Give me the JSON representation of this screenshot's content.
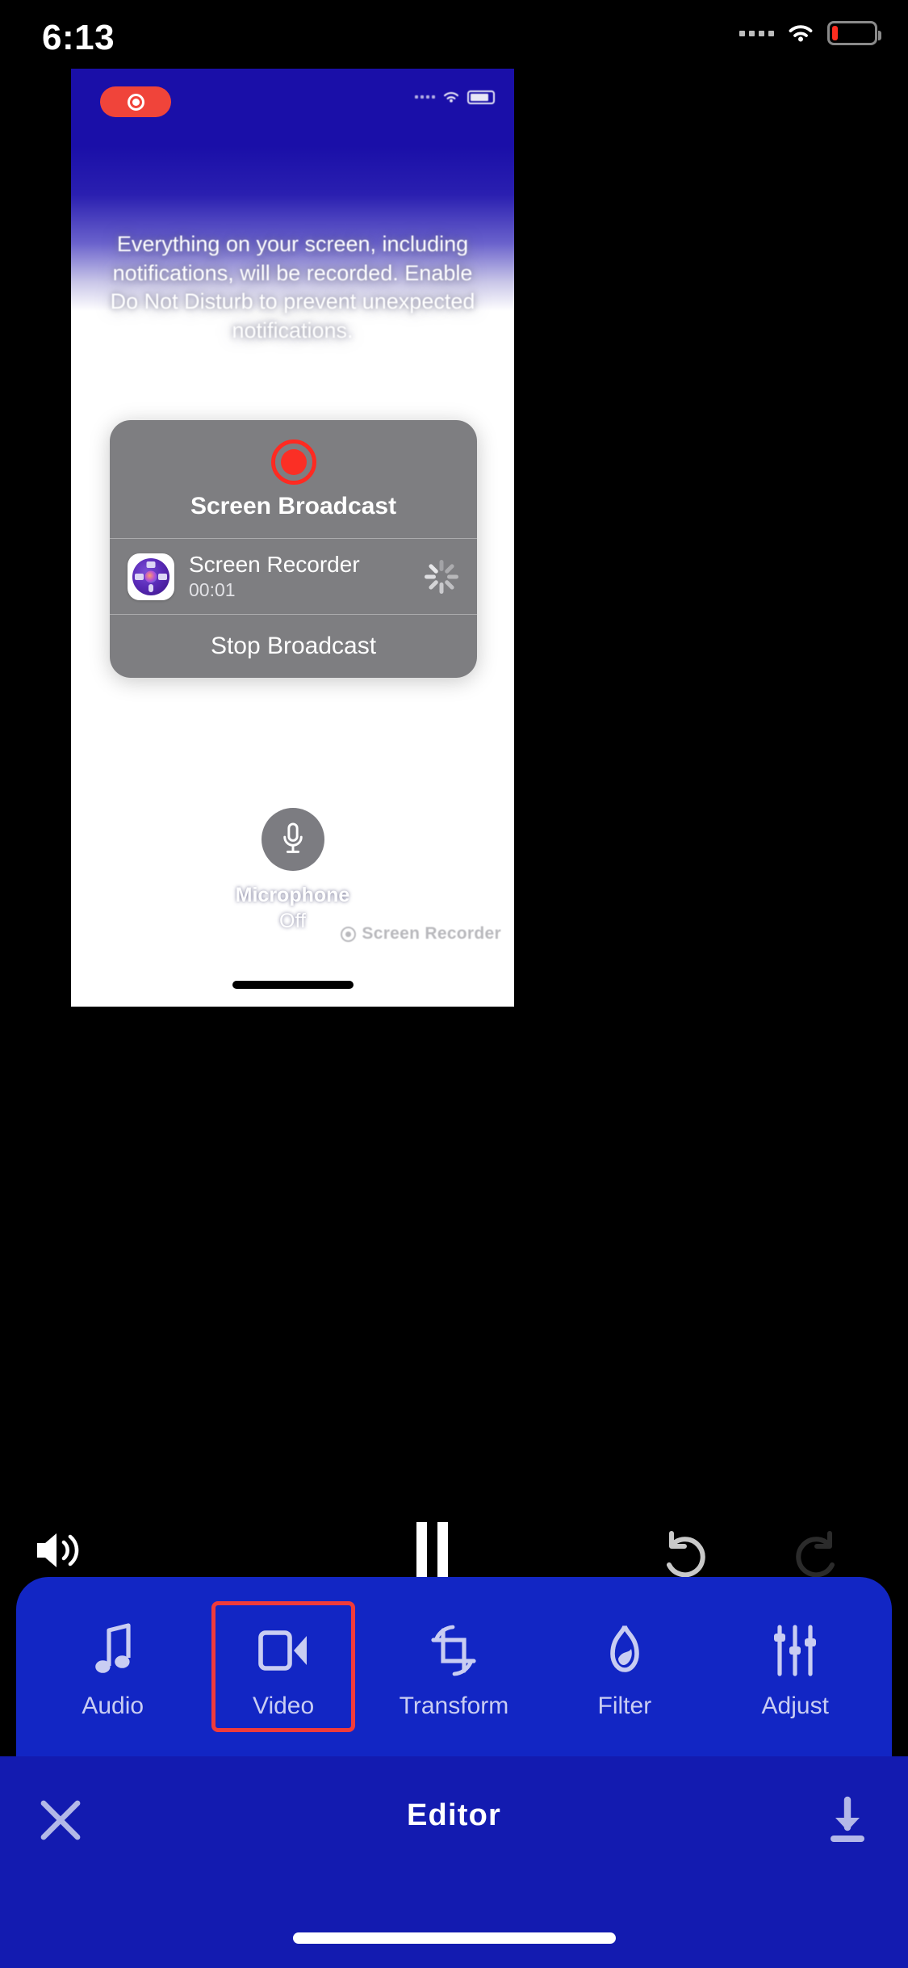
{
  "status_bar": {
    "time": "6:13",
    "cellular_icon": "signal-dots-icon",
    "wifi_icon": "wifi-icon",
    "battery_icon": "battery-low-icon",
    "battery_level_pct": 12,
    "battery_color": "#ff2d1f"
  },
  "preview": {
    "recording_pill": {
      "icon": "record-icon",
      "color": "#f0443a"
    },
    "inner_status": {
      "cellular_icon": "signal-dots-icon",
      "wifi_icon": "wifi-icon",
      "battery_icon": "battery-icon"
    },
    "notice_text": "Everything on your screen, including notifications, will be recorded. Enable Do Not Disturb to prevent unexpected notifications.",
    "alert": {
      "record_icon": "record-circle-icon",
      "title": "Screen Broadcast",
      "app_icon": "screen-recorder-app-icon",
      "app_name": "Screen Recorder",
      "elapsed": "00:01",
      "spinner_icon": "activity-spinner-icon",
      "action_label": "Stop Broadcast",
      "background_color": "#7a7a7d"
    },
    "microphone": {
      "icon": "microphone-icon",
      "label": "Microphone",
      "state": "Off"
    },
    "watermark": {
      "icon": "record-icon",
      "text": "Screen Recorder"
    }
  },
  "playback_controls": [
    {
      "name": "volume-button",
      "icon": "speaker-wave-icon"
    },
    {
      "name": "pause-button",
      "icon": "pause-icon"
    },
    {
      "name": "undo-button",
      "icon": "undo-arrow-icon"
    },
    {
      "name": "redo-button",
      "icon": "redo-arrow-icon"
    }
  ],
  "toolbar": {
    "background_color": "#1226c4",
    "selection_color": "#f03b3b",
    "selected": "Video",
    "items": [
      {
        "label": "Audio",
        "icon": "music-note-icon"
      },
      {
        "label": "Video",
        "icon": "video-camera-icon"
      },
      {
        "label": "Transform",
        "icon": "crop-rotate-icon"
      },
      {
        "label": "Filter",
        "icon": "filter-droplet-icon"
      },
      {
        "label": "Adjust",
        "icon": "sliders-icon"
      }
    ]
  },
  "bottom_bar": {
    "background_color": "#131bb0",
    "close_icon": "close-x-icon",
    "title": "Editor",
    "save_icon": "download-arrow-icon"
  }
}
